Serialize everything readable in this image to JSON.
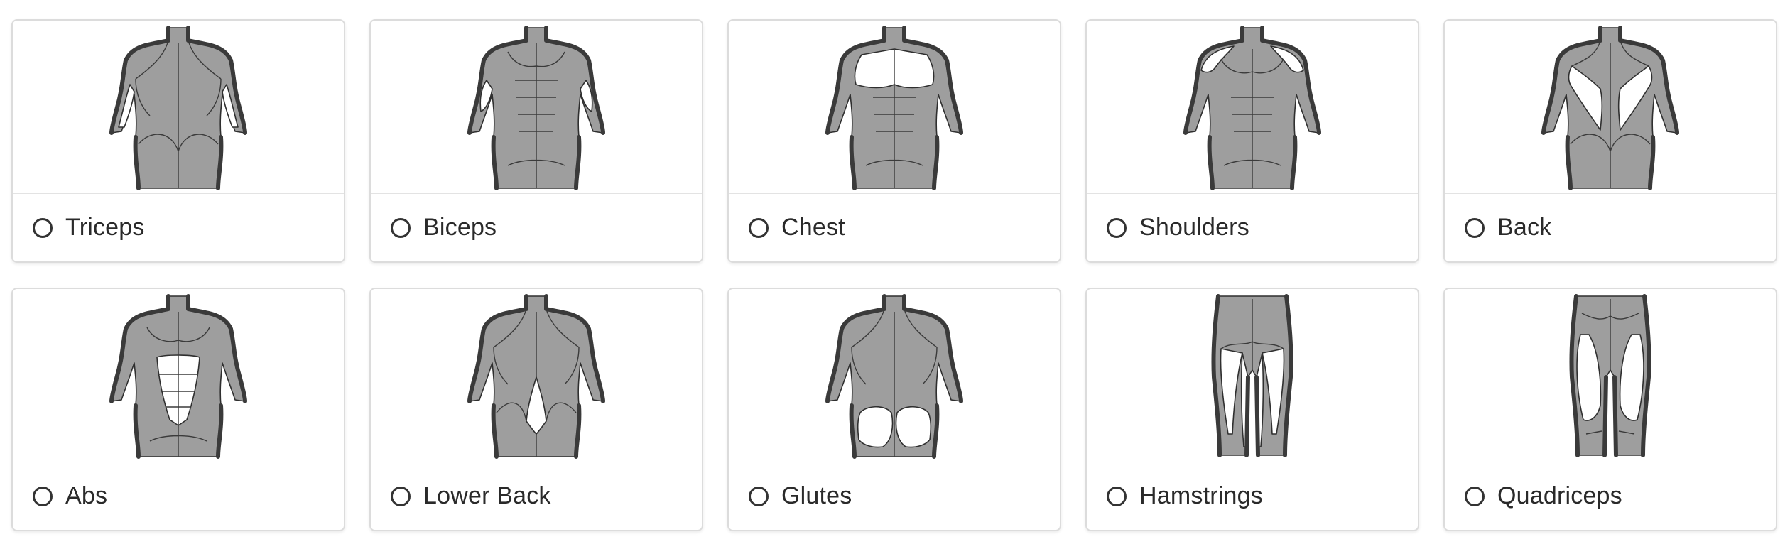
{
  "muscle_groups": [
    {
      "label": "Triceps",
      "icon": "triceps-icon",
      "view": "back",
      "highlight": "triceps"
    },
    {
      "label": "Biceps",
      "icon": "biceps-icon",
      "view": "front",
      "highlight": "biceps"
    },
    {
      "label": "Chest",
      "icon": "chest-icon",
      "view": "front",
      "highlight": "chest"
    },
    {
      "label": "Shoulders",
      "icon": "shoulders-icon",
      "view": "front",
      "highlight": "shoulders"
    },
    {
      "label": "Back",
      "icon": "back-icon",
      "view": "back",
      "highlight": "back"
    },
    {
      "label": "Abs",
      "icon": "abs-icon",
      "view": "front",
      "highlight": "abs"
    },
    {
      "label": "Lower Back",
      "icon": "lower-back-icon",
      "view": "back",
      "highlight": "lower-back"
    },
    {
      "label": "Glutes",
      "icon": "glutes-icon",
      "view": "back",
      "highlight": "glutes"
    },
    {
      "label": "Hamstrings",
      "icon": "hamstrings-icon",
      "view": "legs-back",
      "highlight": "hamstrings"
    },
    {
      "label": "Quadriceps",
      "icon": "quadriceps-icon",
      "view": "legs-front",
      "highlight": "quadriceps"
    }
  ],
  "colors": {
    "muscle": "#9e9e9e",
    "highlight": "#ffffff",
    "outline": "#3a3a3a",
    "border": "#dcdcdc"
  }
}
